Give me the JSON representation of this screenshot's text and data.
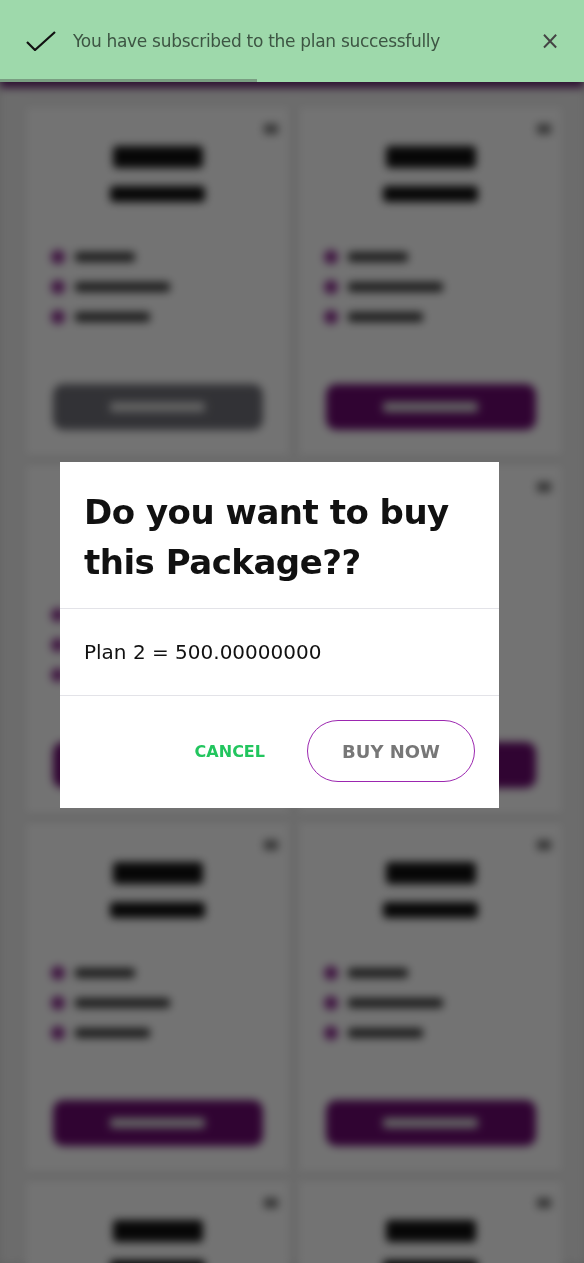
{
  "toast": {
    "message": "You have subscribed to the plan successfully",
    "close": "×",
    "level": 0.44
  },
  "plans": [
    {
      "kind": "full",
      "disabled": true
    },
    {
      "kind": "full",
      "disabled": false
    },
    {
      "kind": "full",
      "disabled": false
    },
    {
      "kind": "full",
      "disabled": false
    },
    {
      "kind": "full",
      "disabled": false
    },
    {
      "kind": "full",
      "disabled": false
    },
    {
      "kind": "partial"
    },
    {
      "kind": "partial"
    }
  ],
  "dialog": {
    "title": "Do you want to buy this Package??",
    "body": "Plan 2 = 500.00000000",
    "buttons": [
      {
        "label": "CANCEL",
        "kind": "text"
      },
      {
        "label": "BUY NOW",
        "kind": "outlined"
      }
    ]
  }
}
